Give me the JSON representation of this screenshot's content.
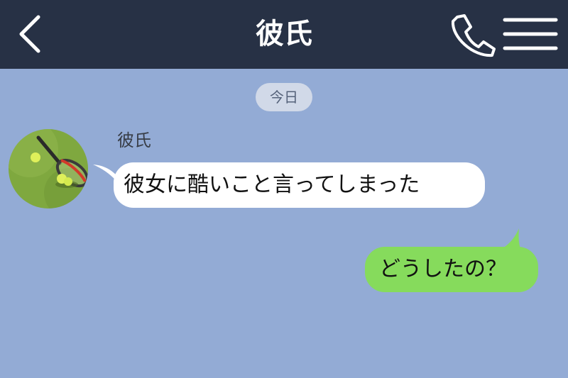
{
  "header": {
    "title": "彼氏",
    "back_icon": "chevron-left-icon",
    "call_icon": "phone-icon",
    "menu_icon": "hamburger-menu-icon",
    "background_color": "#273145"
  },
  "chat": {
    "background_color": "#93abd5",
    "date_label": "今日",
    "messages": [
      {
        "sender": "彼氏",
        "direction": "incoming",
        "avatar": "tennis-racket-avatar",
        "text": "彼女に酷いこと言ってしまった",
        "bubble_color": "#ffffff"
      },
      {
        "direction": "outgoing",
        "text": "どうしたの？",
        "bubble_color": "#86db5c"
      }
    ]
  }
}
